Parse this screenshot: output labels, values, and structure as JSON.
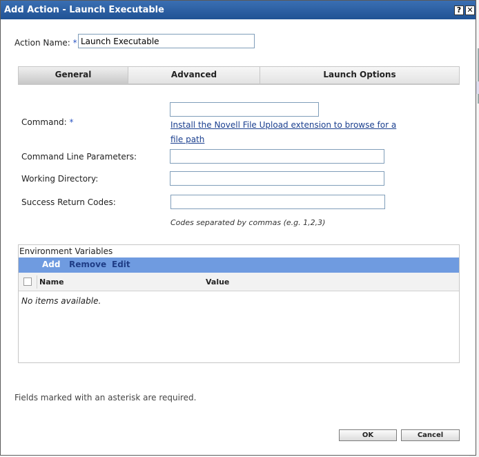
{
  "dialog": {
    "title": "Add Action - Launch Executable",
    "help_glyph": "?",
    "close_glyph": "✕"
  },
  "action_name": {
    "label": "Action Name:",
    "required_mark": "*",
    "value": "Launch Executable"
  },
  "tabs": [
    {
      "label": "General",
      "active": true
    },
    {
      "label": "Advanced",
      "active": false
    },
    {
      "label": "Launch Options",
      "active": false
    }
  ],
  "form": {
    "command_label": "Command:",
    "command_required_mark": "*",
    "command_value": "",
    "install_link_line1": "Install the Novell File Upload extension to browse for a",
    "install_link_line2": "file path",
    "cmd_params_label": "Command Line Parameters:",
    "cmd_params_value": "",
    "working_dir_label": "Working Directory:",
    "working_dir_value": "",
    "success_codes_label": "Success Return Codes:",
    "success_codes_value": "",
    "success_codes_hint": "Codes separated by commas (e.g. 1,2,3)"
  },
  "env": {
    "title": "Environment Variables",
    "toolbar": {
      "add": "Add",
      "remove": "Remove",
      "edit": "Edit"
    },
    "columns": {
      "name": "Name",
      "value": "Value"
    },
    "empty_text": "No items available."
  },
  "footer": {
    "required_note": "Fields marked with an asterisk are required.",
    "ok_label": "OK",
    "cancel_label": "Cancel"
  },
  "colors": {
    "title_bar": "#205294",
    "toolbar": "#6f9be0",
    "link": "#1a3f8f",
    "required_asterisk": "#2b55c4"
  }
}
